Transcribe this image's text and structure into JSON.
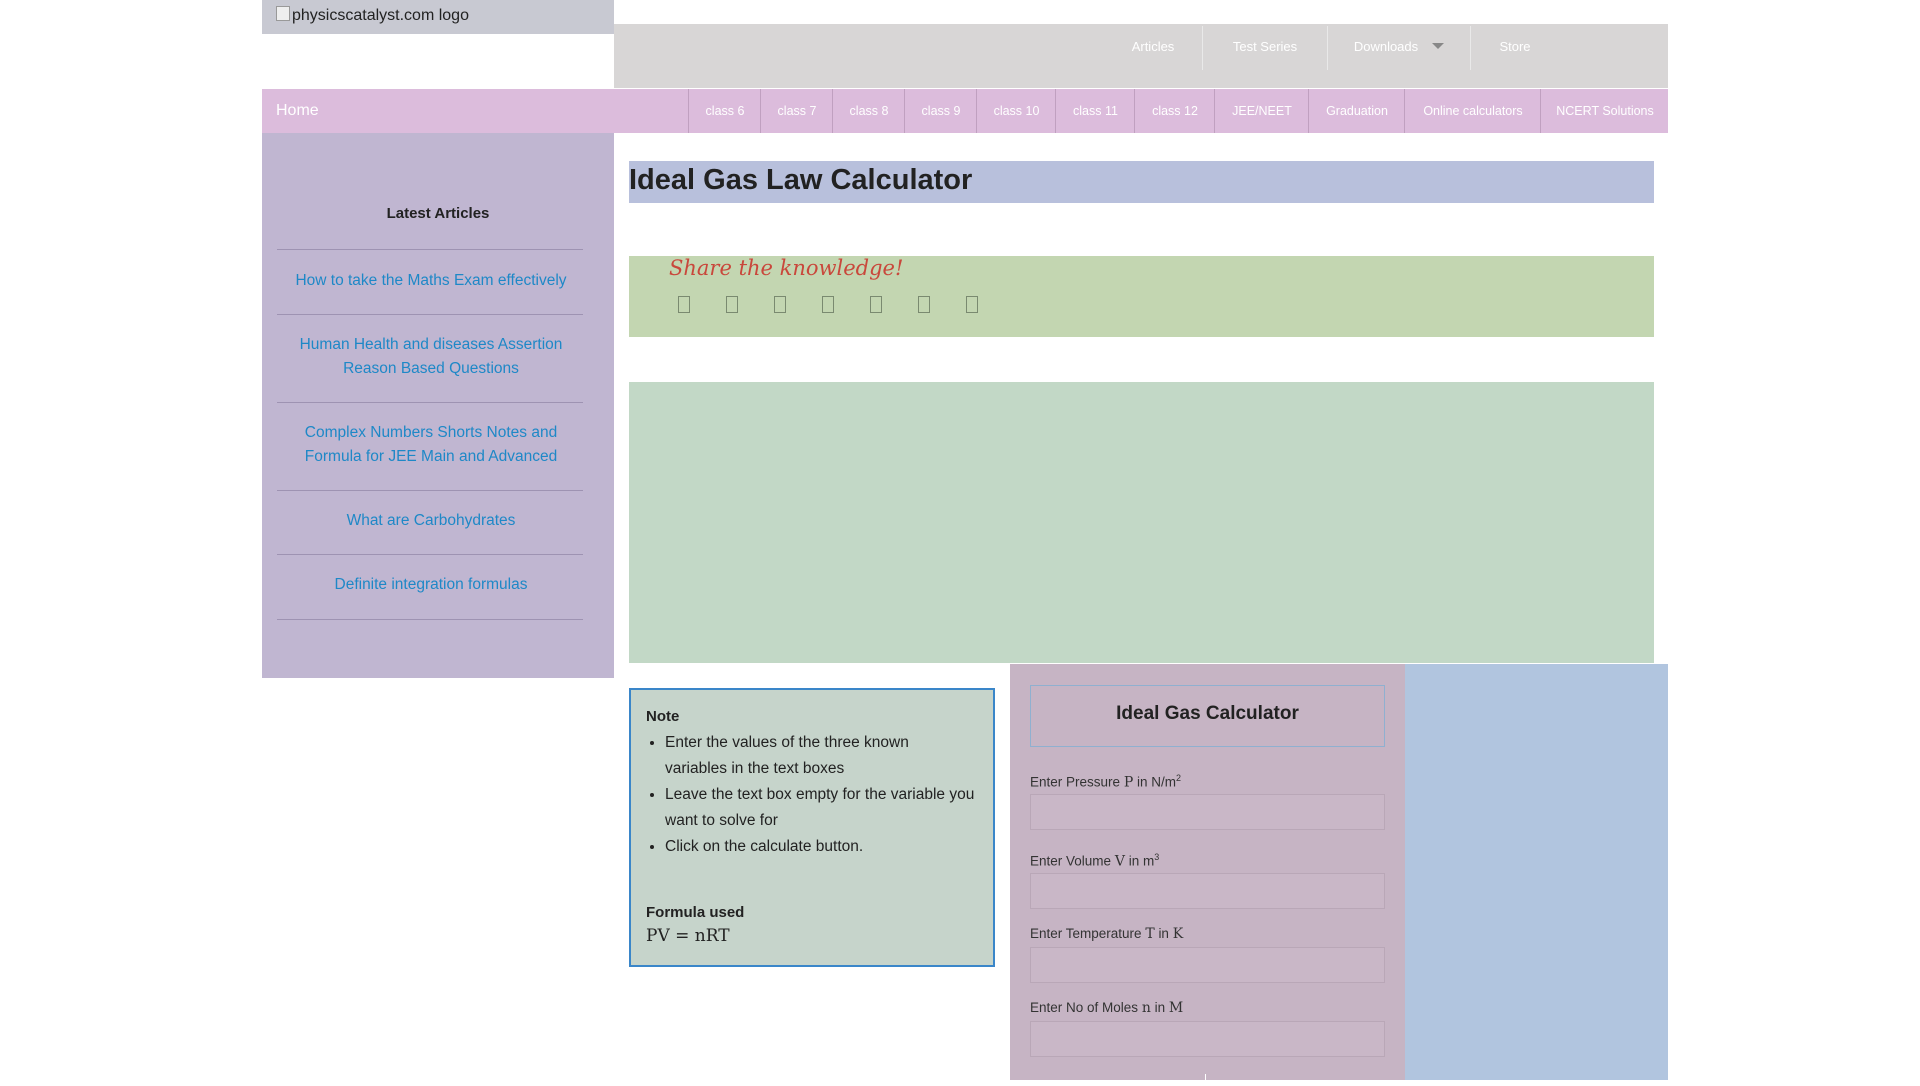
{
  "header": {
    "logo_alt": "physicscatalyst.com logo",
    "top_nav": [
      "Articles",
      "Test Series",
      "Downloads",
      "Store"
    ],
    "home": "Home",
    "main_nav": [
      "class 6",
      "class 7",
      "class 8",
      "class 9",
      "class 10",
      "class 11",
      "class 12",
      "JEE/NEET",
      "Graduation",
      "Online calculators",
      "NCERT Solutions"
    ]
  },
  "sidebar": {
    "title": "Latest Articles",
    "links": [
      "How to take the Maths Exam effectively",
      "Human Health and diseases Assertion Reason Based Questions",
      "Complex Numbers Shorts Notes and Formula for JEE Main and Advanced",
      "What are Carbohydrates",
      "Definite integration formulas"
    ]
  },
  "main": {
    "page_title": "Ideal Gas Law Calculator",
    "share_title": "Share the knowledge!"
  },
  "note": {
    "heading": "Note",
    "items": [
      "Enter the values of the three known variables in the text boxes",
      "Leave the text box empty for the variable you want to solve for",
      "Click on the calculate button."
    ],
    "formula_heading": "Formula used",
    "formula": "PV  = nRT"
  },
  "calculator": {
    "title": "Ideal Gas Calculator",
    "fields": [
      {
        "label_prefix": "Enter Pressure",
        "symbol": "P",
        "unit_text": "in N/m",
        "unit_sup": "2"
      },
      {
        "label_prefix": "Enter Volume",
        "symbol": "V",
        "unit_text": "in m",
        "unit_sup": "3"
      },
      {
        "label_prefix": "Enter Temperature",
        "symbol": "T",
        "unit_text": "in",
        "unit_symbol": "K"
      },
      {
        "label_prefix": "Enter No of Moles",
        "symbol": "n",
        "unit_text": "in",
        "unit_symbol": "M"
      }
    ]
  },
  "colors": {
    "link": "#1e88c7",
    "sidebar_bg": "#c0b6d1",
    "nav_bg": "#dcbcdc",
    "share_title": "#c9473b"
  }
}
